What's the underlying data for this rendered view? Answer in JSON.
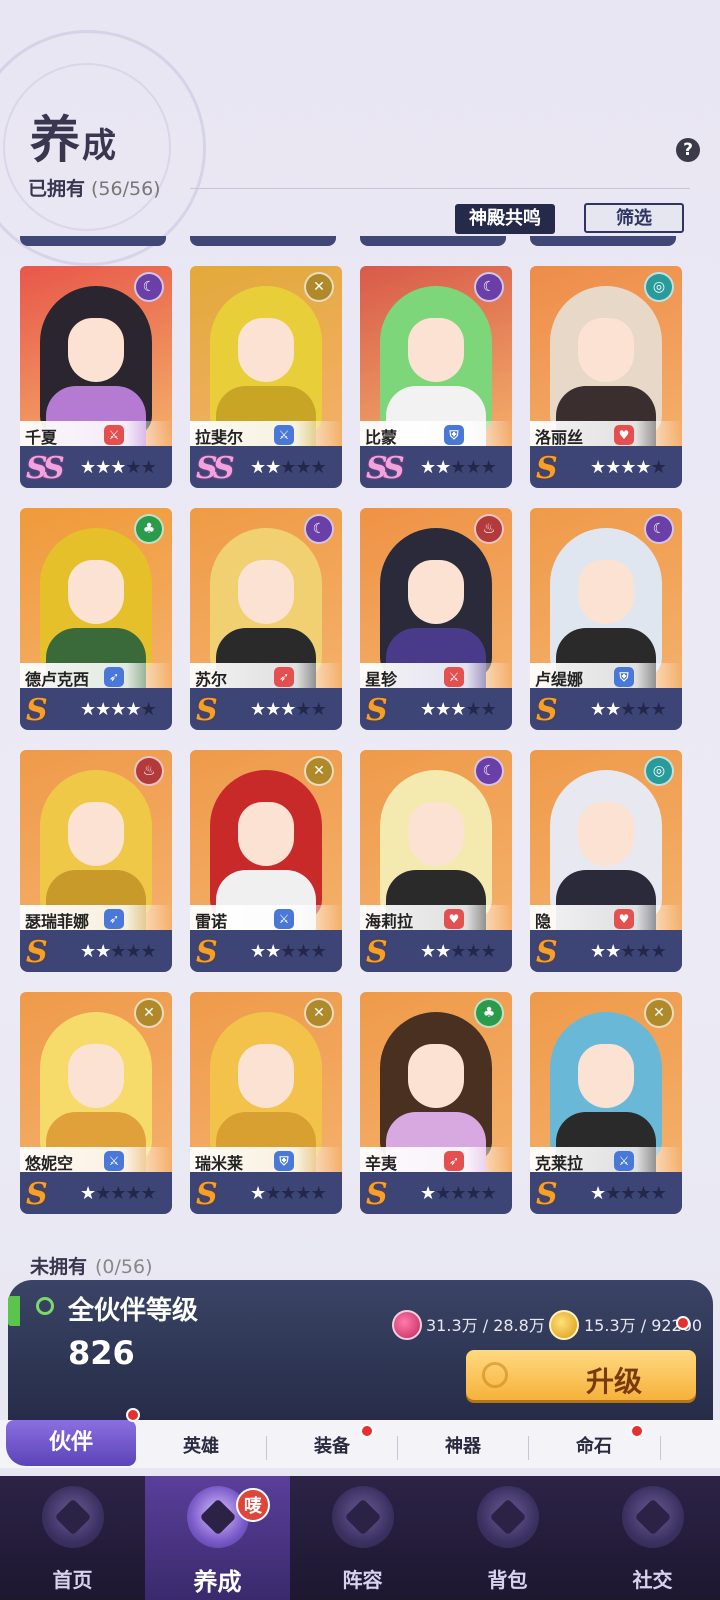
{
  "header": {
    "title_main": "养",
    "title_small": "成",
    "owned_label": "已拥有",
    "owned_count": "(56/56)",
    "help_icon": "?",
    "temple_button": "神殿共鸣",
    "filter_button": "筛选"
  },
  "cards": [
    {
      "name": "千夏",
      "rank": "SS",
      "stars": 3,
      "element": "moon",
      "element_color": "#6a3fa8",
      "bg": "#e8574a",
      "hair": "#2b2530",
      "body": "#b57ad2",
      "role_color": "#e45050",
      "role": "剑"
    },
    {
      "name": "拉斐尔",
      "rank": "SS",
      "stars": 2,
      "element": "sword",
      "element_color": "#b08a2a",
      "bg": "#e2a93a",
      "hair": "#e8cf3a",
      "body": "#c8a525",
      "role_color": "#4a78d8",
      "role": "剑"
    },
    {
      "name": "比蒙",
      "rank": "SS",
      "stars": 2,
      "element": "moon",
      "element_color": "#6a3fa8",
      "bg": "#d85a4a",
      "hair": "#7ed67a",
      "body": "#f2f2f2",
      "role_color": "#4a78d8",
      "role": "盾"
    },
    {
      "name": "洛丽丝",
      "rank": "S",
      "stars": 4,
      "element": "wind",
      "element_color": "#2a9b9b",
      "bg": "#ee8c4a",
      "hair": "#e8d8c8",
      "body": "#3a2e2e",
      "role_color": "#e45050",
      "role": "心"
    },
    {
      "name": "德卢克西",
      "rank": "S",
      "stars": 4,
      "element": "leaf",
      "element_color": "#2a9b4a",
      "bg": "#f09a3a",
      "hair": "#e6c02a",
      "body": "#3a6a3a",
      "role_color": "#4a78d8",
      "role": "弓"
    },
    {
      "name": "苏尔",
      "rank": "S",
      "stars": 3,
      "element": "moon",
      "element_color": "#6a3fa8",
      "bg": "#ef9b45",
      "hair": "#f0d070",
      "body": "#2a2a2a",
      "role_color": "#e45050",
      "role": "弓"
    },
    {
      "name": "星轸",
      "rank": "S",
      "stars": 3,
      "element": "fire",
      "element_color": "#b23a3a",
      "bg": "#ef9245",
      "hair": "#2a2a3a",
      "body": "#4a3a8a",
      "role_color": "#e45050",
      "role": "剑"
    },
    {
      "name": "卢缇娜",
      "rank": "S",
      "stars": 2,
      "element": "moon",
      "element_color": "#6a3fa8",
      "bg": "#ef9a4a",
      "hair": "#e0e6f0",
      "body": "#2a2a2a",
      "role_color": "#4a78d8",
      "role": "盾"
    },
    {
      "name": "瑟瑞菲娜",
      "rank": "S",
      "stars": 2,
      "element": "fire",
      "element_color": "#b23a3a",
      "bg": "#ef9a4a",
      "hair": "#f0c848",
      "body": "#c89a2a",
      "role_color": "#4a78d8",
      "role": "弓"
    },
    {
      "name": "雷诺",
      "rank": "S",
      "stars": 2,
      "element": "sword",
      "element_color": "#b08a2a",
      "bg": "#ef9a4a",
      "hair": "#c82a2a",
      "body": "#f0f0f0",
      "role_color": "#4a78d8",
      "role": "剑"
    },
    {
      "name": "海莉拉",
      "rank": "S",
      "stars": 2,
      "element": "moon",
      "element_color": "#6a3fa8",
      "bg": "#ef9a4a",
      "hair": "#f4eab0",
      "body": "#2a2a2a",
      "role_color": "#e45050",
      "role": "心"
    },
    {
      "name": "隐",
      "rank": "S",
      "stars": 2,
      "element": "wind",
      "element_color": "#2a9b9b",
      "bg": "#ef9a4a",
      "hair": "#e8e8f0",
      "body": "#2a2a3a",
      "role_color": "#e45050",
      "role": "心"
    },
    {
      "name": "悠妮空",
      "rank": "S",
      "stars": 1,
      "element": "sword",
      "element_color": "#b08a2a",
      "bg": "#ef9a4a",
      "hair": "#f6da6a",
      "body": "#e0a03a",
      "role_color": "#4a78d8",
      "role": "剑"
    },
    {
      "name": "瑞米莱",
      "rank": "S",
      "stars": 1,
      "element": "sword",
      "element_color": "#b08a2a",
      "bg": "#ef9a4a",
      "hair": "#f2c24a",
      "body": "#d8a030",
      "role_color": "#4a78d8",
      "role": "盾"
    },
    {
      "name": "辛夷",
      "rank": "S",
      "stars": 1,
      "element": "leaf",
      "element_color": "#2a9b4a",
      "bg": "#ef9a4a",
      "hair": "#4a3020",
      "body": "#d8a8e0",
      "role_color": "#e45050",
      "role": "弓"
    },
    {
      "name": "克莱拉",
      "rank": "S",
      "stars": 1,
      "element": "sword",
      "element_color": "#b08a2a",
      "bg": "#ef9a4a",
      "hair": "#6ab8d8",
      "body": "#2a2a2a",
      "role_color": "#4a78d8",
      "role": "剑"
    }
  ],
  "unowned": {
    "label": "未拥有",
    "count": "(0/56)"
  },
  "level_panel": {
    "label": "全伙伴等级",
    "value": "826",
    "res1": "31.3万 / 28.8万",
    "res2": "15.3万 / 92200",
    "upgrade_button": "升级"
  },
  "subnav": {
    "items": [
      "伙伴",
      "英雄",
      "装备",
      "神器",
      "命石"
    ]
  },
  "tabbar": {
    "items": [
      "首页",
      "养成",
      "阵容",
      "背包",
      "社交"
    ],
    "badge": "唛"
  }
}
